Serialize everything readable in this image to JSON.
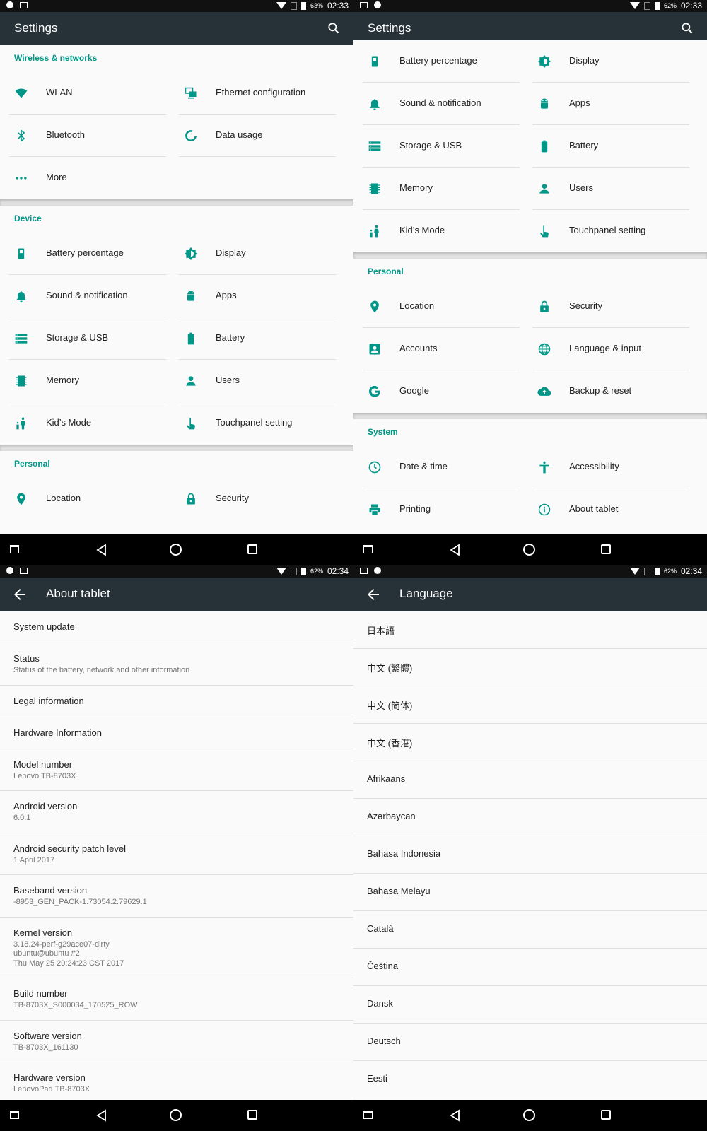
{
  "panels": {
    "tl": {
      "status": {
        "battery": "63%",
        "time": "02:33"
      },
      "title": "Settings",
      "sections": [
        {
          "header": "Wireless & networks",
          "items": [
            {
              "label": "WLAN",
              "icon": "wifi-icon"
            },
            {
              "label": "Ethernet configuration",
              "icon": "ethernet-icon"
            },
            {
              "label": "Bluetooth",
              "icon": "bluetooth-icon"
            },
            {
              "label": "Data usage",
              "icon": "data-usage-icon"
            },
            {
              "label": "More",
              "icon": "more-icon"
            }
          ]
        },
        {
          "header": "Device",
          "items": [
            {
              "label": "Battery percentage",
              "icon": "battery-percentage-icon"
            },
            {
              "label": "Display",
              "icon": "display-icon"
            },
            {
              "label": "Sound & notification",
              "icon": "bell-icon"
            },
            {
              "label": "Apps",
              "icon": "android-icon"
            },
            {
              "label": "Storage & USB",
              "icon": "storage-icon"
            },
            {
              "label": "Battery",
              "icon": "battery-icon"
            },
            {
              "label": "Memory",
              "icon": "memory-icon"
            },
            {
              "label": "Users",
              "icon": "person-icon"
            },
            {
              "label": "Kid’s Mode",
              "icon": "kids-icon"
            },
            {
              "label": "Touchpanel setting",
              "icon": "touch-icon"
            }
          ]
        },
        {
          "header": "Personal",
          "items": [
            {
              "label": "Location",
              "icon": "location-icon"
            },
            {
              "label": "Security",
              "icon": "lock-icon"
            }
          ]
        }
      ]
    },
    "tr": {
      "status": {
        "battery": "62%",
        "time": "02:33"
      },
      "title": "Settings",
      "sections": [
        {
          "header": "",
          "items": [
            {
              "label": "Battery percentage",
              "icon": "battery-percentage-icon"
            },
            {
              "label": "Display",
              "icon": "display-icon"
            },
            {
              "label": "Sound & notification",
              "icon": "bell-icon"
            },
            {
              "label": "Apps",
              "icon": "android-icon"
            },
            {
              "label": "Storage & USB",
              "icon": "storage-icon"
            },
            {
              "label": "Battery",
              "icon": "battery-icon"
            },
            {
              "label": "Memory",
              "icon": "memory-icon"
            },
            {
              "label": "Users",
              "icon": "person-icon"
            },
            {
              "label": "Kid’s Mode",
              "icon": "kids-icon"
            },
            {
              "label": "Touchpanel setting",
              "icon": "touch-icon"
            }
          ]
        },
        {
          "header": "Personal",
          "items": [
            {
              "label": "Location",
              "icon": "location-icon"
            },
            {
              "label": "Security",
              "icon": "lock-icon"
            },
            {
              "label": "Accounts",
              "icon": "account-icon"
            },
            {
              "label": "Language & input",
              "icon": "globe-icon"
            },
            {
              "label": "Google",
              "icon": "google-icon"
            },
            {
              "label": "Backup & reset",
              "icon": "cloud-upload-icon"
            }
          ]
        },
        {
          "header": "System",
          "items": [
            {
              "label": "Date & time",
              "icon": "clock-icon"
            },
            {
              "label": "Accessibility",
              "icon": "accessibility-icon"
            },
            {
              "label": "Printing",
              "icon": "printer-icon"
            },
            {
              "label": "About tablet",
              "icon": "info-icon"
            }
          ]
        }
      ]
    },
    "bl": {
      "status": {
        "battery": "62%",
        "time": "02:34"
      },
      "title": "About tablet",
      "items": [
        {
          "title": "System update",
          "summary": ""
        },
        {
          "title": "Status",
          "summary": "Status of the battery, network and other information"
        },
        {
          "title": "Legal information",
          "summary": ""
        },
        {
          "title": "Hardware Information",
          "summary": ""
        },
        {
          "title": "Model number",
          "summary": "Lenovo TB-8703X"
        },
        {
          "title": "Android version",
          "summary": "6.0.1"
        },
        {
          "title": "Android security patch level",
          "summary": "1 April 2017"
        },
        {
          "title": "Baseband version",
          "summary": "-8953_GEN_PACK-1.73054.2.79629.1"
        },
        {
          "title": "Kernel version",
          "summary": "3.18.24-perf-g29ace07-dirty\nubuntu@ubuntu #2\nThu May 25 20:24:23 CST 2017"
        },
        {
          "title": "Build number",
          "summary": "TB-8703X_S000034_170525_ROW"
        },
        {
          "title": "Software version",
          "summary": "TB-8703X_161130"
        },
        {
          "title": "Hardware version",
          "summary": "LenovoPad TB-8703X"
        }
      ]
    },
    "br": {
      "status": {
        "battery": "62%",
        "time": "02:34"
      },
      "title": "Language",
      "items": [
        "日本語",
        "中文 (繁體)",
        "中文 (简体)",
        "中文 (香港)",
        "Afrikaans",
        "Azərbaycan",
        "Bahasa Indonesia",
        "Bahasa Melayu",
        "Català",
        "Čeština",
        "Dansk",
        "Deutsch",
        "Eesti"
      ]
    }
  },
  "colors": {
    "accent": "#009688",
    "appbar": "#263238",
    "statusbar": "#111111",
    "background": "#fafafa"
  }
}
